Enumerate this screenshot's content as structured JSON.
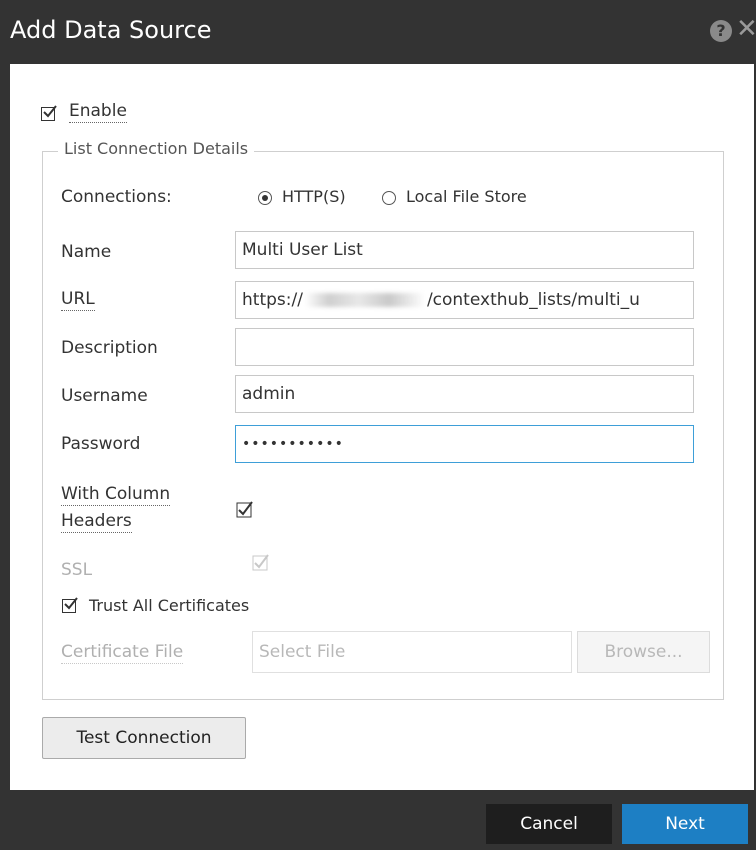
{
  "dialog": {
    "title": "Add Data Source",
    "help_icon": "?",
    "close_icon": "✕"
  },
  "enable": {
    "label": "Enable",
    "checked": true
  },
  "connection_details": {
    "legend": "List Connection Details",
    "connections_label": "Connections:",
    "options": [
      {
        "label": "HTTP(S)",
        "selected": true
      },
      {
        "label": "Local File Store",
        "selected": false
      }
    ],
    "fields": {
      "name": {
        "label": "Name",
        "value": "Multi User List"
      },
      "url": {
        "label": "URL",
        "value_prefix": "https://",
        "value_suffix": "/contexthub_lists/multi_u"
      },
      "description": {
        "label": "Description",
        "value": ""
      },
      "username": {
        "label": "Username",
        "value": "admin"
      },
      "password": {
        "label": "Password",
        "value": "•••••••••••"
      }
    },
    "with_column_headers": {
      "label_line1": "With Column",
      "label_line2": "Headers",
      "checked": true
    },
    "ssl": {
      "label": "SSL",
      "checked": true,
      "disabled": true
    },
    "trust_all_certificates": {
      "label": "Trust All Certificates",
      "checked": true
    },
    "certificate_file": {
      "label": "Certificate File",
      "placeholder": "Select File",
      "browse_label": "Browse..."
    }
  },
  "buttons": {
    "test_connection": "Test Connection",
    "cancel": "Cancel",
    "next": "Next"
  },
  "colors": {
    "titlebar": "#333333",
    "primary": "#1d7fc4",
    "focus": "#3e9fd8"
  }
}
